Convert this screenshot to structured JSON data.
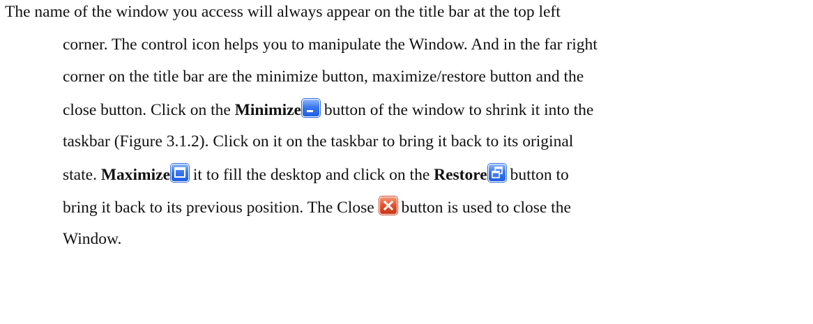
{
  "paragraph": {
    "line1": "The name of the window you access will always appear on the title bar at the top left",
    "line2": "corner. The control icon helps you to manipulate the Window. And in the far right",
    "line3": "corner on the title bar are the minimize button, maximize/restore button and the",
    "line4_a": "close button. Click on the ",
    "line4_minimize": "Minimize",
    "line4_b": " button of the window to shrink it into the",
    "line5": "taskbar (Figure 3.1.2). Click on it on the taskbar to bring it back to its original",
    "line6_a": "state. ",
    "line6_maximize": "Maximize",
    "line6_b": " it to fill the desktop and click on the ",
    "line6_restore": "Restore",
    "line6_c": " button to",
    "line7_a": "bring it back to its previous position. The Close ",
    "line7_b": " button is used to close the",
    "line8": "Window."
  },
  "icons": {
    "minimize": "minimize-icon",
    "maximize": "maximize-icon",
    "restore": "restore-icon",
    "close": "close-icon"
  },
  "colors": {
    "text": "#111111",
    "button_blue": "#2f6ee8",
    "button_red": "#e2502c"
  }
}
